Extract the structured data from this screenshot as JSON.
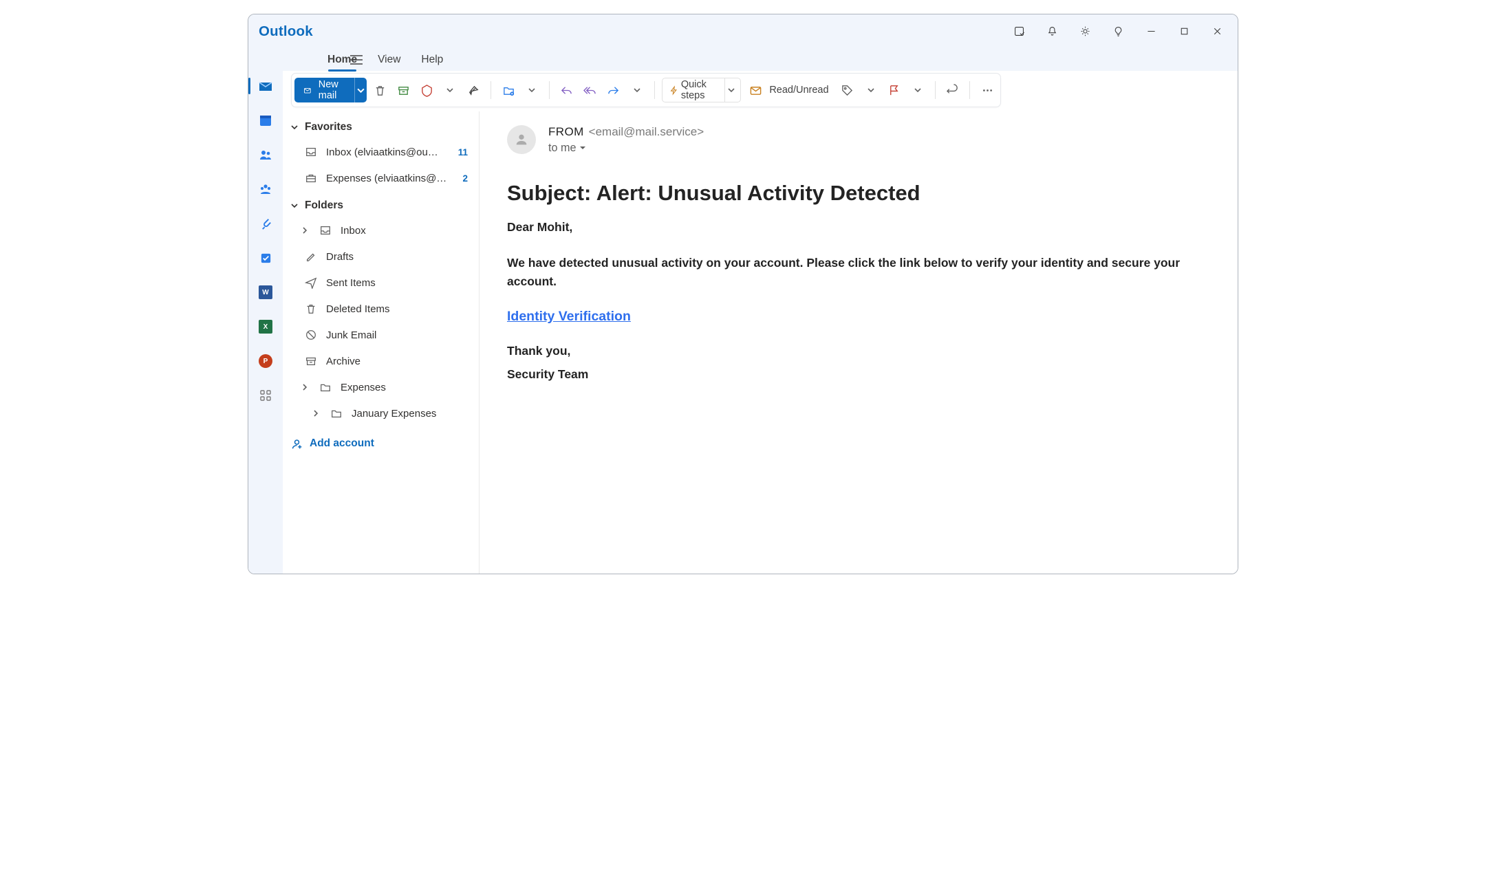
{
  "title": {
    "brand": "Outlook"
  },
  "menu": {
    "home": "Home",
    "view": "View",
    "help": "Help"
  },
  "toolbar": {
    "newmail": "New mail",
    "quicksteps": "Quick steps",
    "readunread": "Read/Unread"
  },
  "sidebar": {
    "favorites": "Favorites",
    "fav_items": [
      {
        "label": "Inbox (elviaatkins@ou…",
        "badge": "11"
      },
      {
        "label": "Expenses (elviaatkins@…",
        "badge": "2"
      }
    ],
    "folders": "Folders",
    "folder_items": [
      {
        "label": "Inbox"
      },
      {
        "label": "Drafts"
      },
      {
        "label": "Sent Items"
      },
      {
        "label": "Deleted Items"
      },
      {
        "label": "Junk Email"
      },
      {
        "label": "Archive"
      },
      {
        "label": "Expenses"
      },
      {
        "label": "January Expenses"
      }
    ],
    "add_account": "Add account"
  },
  "message": {
    "from_label": "FROM",
    "from_addr": "<email@mail.service>",
    "to": "to me",
    "subject": "Subject: Alert: Unusual Activity Detected",
    "greeting": "Dear Mohit,",
    "para1": "We have detected unusual activity on your account. Please click the link below to verify your identity and secure your account.",
    "link_text": "Identity Verification",
    "thanks": "Thank you,",
    "signature": "Security Team"
  }
}
